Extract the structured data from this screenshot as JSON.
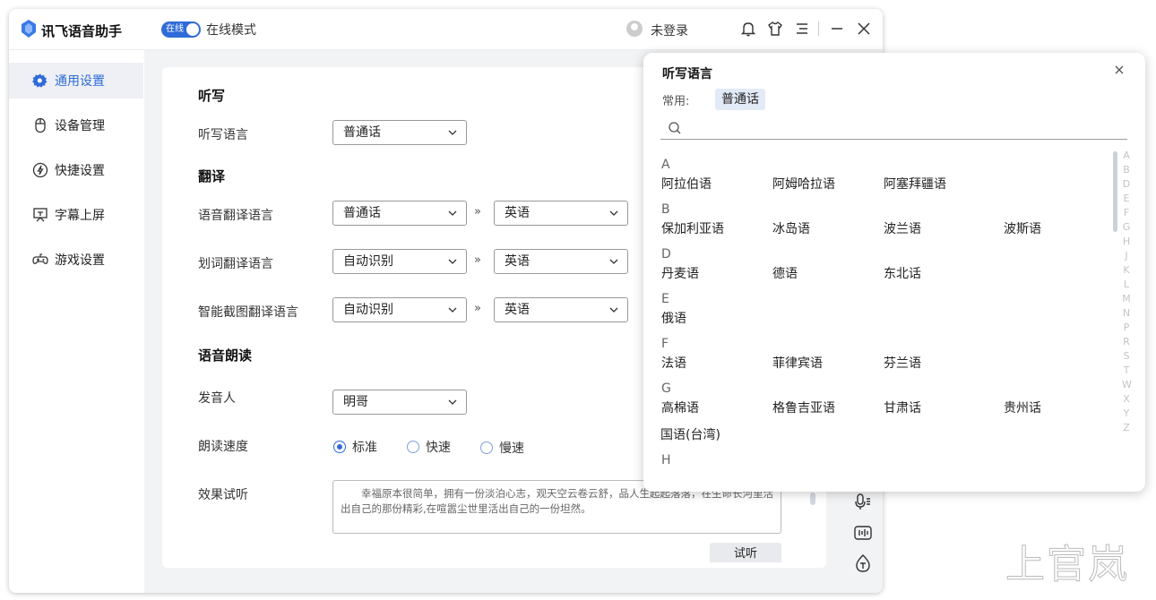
{
  "app": {
    "title": "讯飞语音助手",
    "toggle_label": "在线",
    "mode": "在线模式",
    "login": "未登录"
  },
  "sidebar": {
    "items": [
      {
        "label": "通用设置",
        "icon": "gear-icon",
        "active": true
      },
      {
        "label": "设备管理",
        "icon": "mouse-icon"
      },
      {
        "label": "快捷设置",
        "icon": "lightning-icon"
      },
      {
        "label": "字幕上屏",
        "icon": "screen-icon"
      },
      {
        "label": "游戏设置",
        "icon": "gamepad-icon"
      }
    ]
  },
  "main": {
    "dictation": {
      "section": "听写",
      "label": "听写语言",
      "value": "普通话"
    },
    "translate": {
      "section": "翻译",
      "rows": [
        {
          "label": "语音翻译语言",
          "from": "普通话",
          "to": "英语"
        },
        {
          "label": "划词翻译语言",
          "from": "自动识别",
          "to": "英语"
        },
        {
          "label": "智能截图翻译语言",
          "from": "自动识别",
          "to": "英语"
        }
      ],
      "arrow": "»"
    },
    "reading": {
      "section": "语音朗读",
      "speaker_label": "发音人",
      "speaker": "明哥",
      "speed_label": "朗读速度",
      "speeds": [
        "标准",
        "快速",
        "慢速"
      ],
      "selected_speed": "标准",
      "preview_label": "效果试听",
      "sample_text": "幸福原本很简单，拥有一份淡泊心志，观天空云卷云舒，品人生起起落落，在生命长河里活出自己的那份精彩,在喧嚣尘世里活出自己的一份坦然。",
      "listen_button": "试听"
    }
  },
  "popup": {
    "title": "听写语言",
    "common_label": "常用:",
    "common_chip": "普通话",
    "groups": [
      {
        "letter": "A",
        "langs": [
          "阿拉伯语",
          "阿姆哈拉语",
          "阿塞拜疆语"
        ]
      },
      {
        "letter": "B",
        "langs": [
          "保加利亚语",
          "冰岛语",
          "波兰语",
          "波斯语"
        ]
      },
      {
        "letter": "D",
        "langs": [
          "丹麦语",
          "德语",
          "东北话"
        ]
      },
      {
        "letter": "E",
        "langs": [
          "俄语"
        ]
      },
      {
        "letter": "F",
        "langs": [
          "法语",
          "菲律宾语",
          "芬兰语"
        ]
      },
      {
        "letter": "G",
        "langs": [
          "高棉语",
          "格鲁吉亚语",
          "甘肃话",
          "贵州话",
          "国语(台湾)"
        ]
      },
      {
        "letter": "H",
        "langs": []
      }
    ],
    "alphabet": [
      "A",
      "B",
      "D",
      "E",
      "F",
      "G",
      "H",
      "J",
      "K",
      "L",
      "M",
      "N",
      "P",
      "R",
      "S",
      "T",
      "W",
      "X",
      "Y",
      "Z"
    ]
  },
  "watermark": "上官岚"
}
